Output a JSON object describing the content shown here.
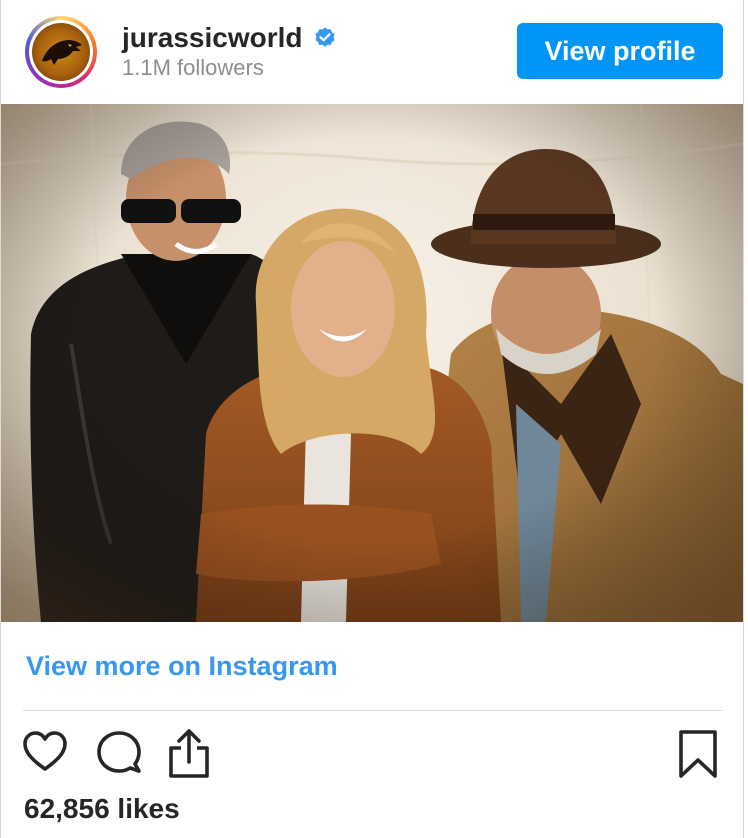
{
  "header": {
    "username": "jurassicworld",
    "followers": "1.1M followers",
    "view_profile_label": "View profile",
    "avatar_icon": "jurassic-world-logo-icon",
    "verified_icon": "verified-badge-icon"
  },
  "post": {
    "image_icon": "post-photo",
    "view_more_label": "View more on Instagram",
    "likes": "62,856 likes"
  },
  "actions": {
    "like_icon": "heart-icon",
    "comment_icon": "comment-icon",
    "share_icon": "share-icon",
    "save_icon": "bookmark-icon"
  },
  "colors": {
    "primary_blue": "#0095f6",
    "link_blue": "#3897f0",
    "text": "#262626",
    "muted": "#8e8e8e"
  }
}
